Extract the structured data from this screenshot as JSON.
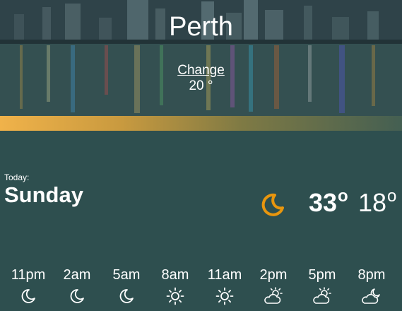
{
  "header": {
    "city": "Perth",
    "change_label": "Change",
    "current_temp": "20 °"
  },
  "today": {
    "label": "Today:",
    "day": "Sunday",
    "icon": "moon-icon",
    "high": "33",
    "low": "18",
    "degree_symbol": "o",
    "icon_color": "#e8960e"
  },
  "hourly": [
    {
      "time": "11pm",
      "icon": "moon-icon"
    },
    {
      "time": "2am",
      "icon": "moon-icon"
    },
    {
      "time": "5am",
      "icon": "moon-icon"
    },
    {
      "time": "8am",
      "icon": "sun-icon"
    },
    {
      "time": "11am",
      "icon": "sun-icon"
    },
    {
      "time": "2pm",
      "icon": "partly-cloudy-day-icon"
    },
    {
      "time": "5pm",
      "icon": "partly-cloudy-day-icon"
    },
    {
      "time": "8pm",
      "icon": "partly-cloudy-night-icon"
    }
  ],
  "colors": {
    "background": "#2e4f4f",
    "accent_start": "#f0b24a",
    "accent_end": "#445f52"
  }
}
